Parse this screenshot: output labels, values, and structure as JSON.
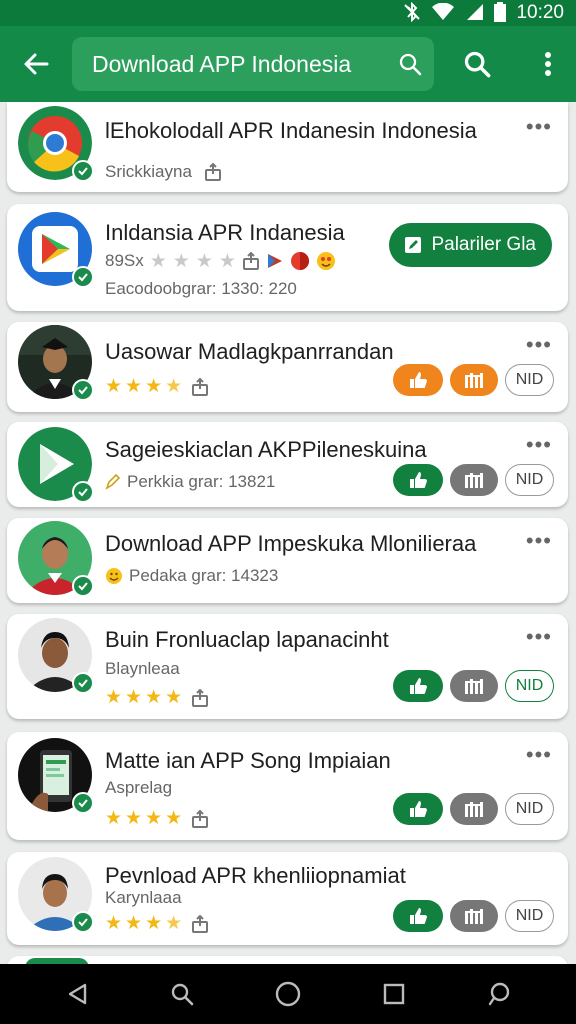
{
  "status_bar": {
    "time": "10:20",
    "icons": [
      "bluetooth-off-icon",
      "wifi-icon",
      "signal-icon",
      "battery-icon"
    ]
  },
  "toolbar": {
    "search_value": "Download APP Indonesia",
    "icons": [
      "back-arrow-icon",
      "search-icon",
      "search-icon",
      "more-vert-icon"
    ]
  },
  "apps": [
    {
      "title": "lEhokolodall APR Indanesin Indonesia",
      "subtitle": "Srickkiayna",
      "colors": [
        "#1a8b4a",
        "#e33b2e",
        "#f7c11a",
        "#2e7bd6"
      ]
    },
    {
      "title": "Inldansia APR Indanesia",
      "stat_prefix": "89Sx",
      "subtitle": "Eacodoobgrar: 1330: 220",
      "button": "Palariler Gla",
      "stars": 0
    },
    {
      "title": "Uasowar Madlagkpanrrandan",
      "stars": 3,
      "nid": "NID"
    },
    {
      "title": "Sageieskiaclan AKPPileneskuina",
      "subtitle": "Perkkia grar: 13821",
      "nid": "NID"
    },
    {
      "title": "Download APP Impeskuka Mlonilieraa",
      "subtitle": "Pedaka grar: 14323"
    },
    {
      "title": "Buin Fronluaclap lapanacinht",
      "subtitle": "Blaynleaa",
      "stars": 4,
      "nid": "NID"
    },
    {
      "title": "Matte ian APP Song Impiaian",
      "subtitle": "Asprelag",
      "stars": 4,
      "nid": "NID"
    },
    {
      "title": "Pevnload APR khenliiopnamiat",
      "subtitle": "Karynlaaa",
      "stars": 3,
      "nid": "NID"
    }
  ],
  "nav_bar": {
    "icons": [
      "back-triangle-icon",
      "search-icon",
      "home-circle-icon",
      "recents-square-icon",
      "assistant-icon"
    ]
  },
  "colors": {
    "primary": "#138a48",
    "status_bar": "#0b7a3b",
    "accent_orange": "#f0851d",
    "star": "#f3b814"
  }
}
